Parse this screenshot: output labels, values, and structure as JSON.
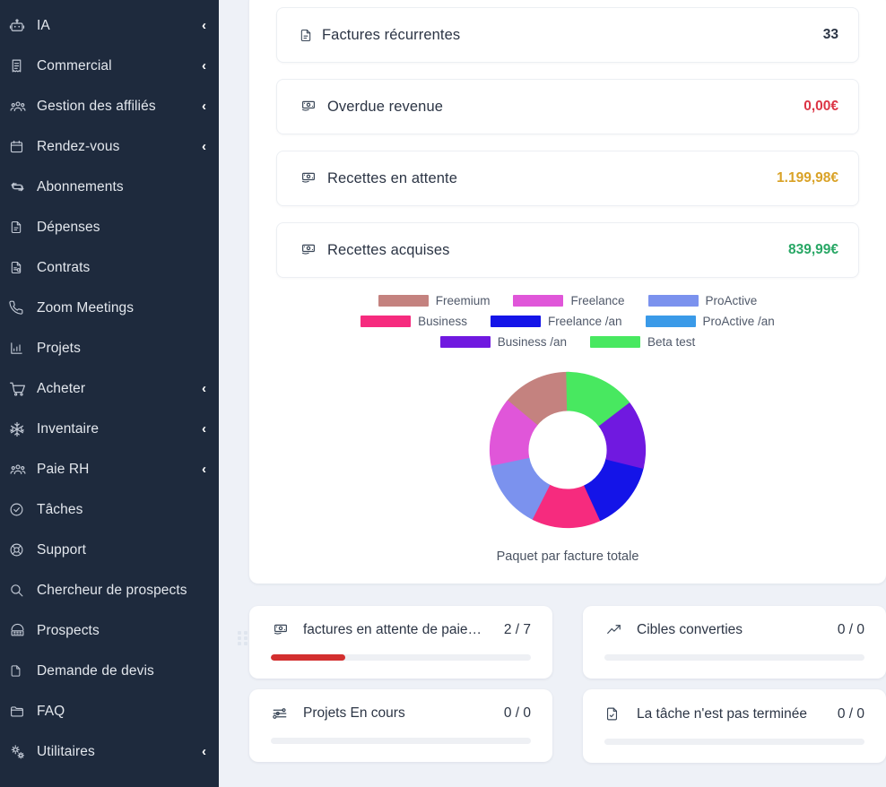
{
  "sidebar": {
    "items": [
      {
        "label": "IA",
        "icon": "robot-icon",
        "caret": "‹",
        "has_caret": true
      },
      {
        "label": "Commercial",
        "icon": "receipt-icon",
        "caret": "‹",
        "has_caret": true
      },
      {
        "label": "Gestion des affiliés",
        "icon": "users-group-icon",
        "caret": "‹",
        "has_caret": true
      },
      {
        "label": "Rendez-vous",
        "icon": "calendar-icon",
        "caret": "‹",
        "has_caret": true
      },
      {
        "label": "Abonnements",
        "icon": "refresh-cycle-icon",
        "caret": "",
        "has_caret": false
      },
      {
        "label": "Dépenses",
        "icon": "document-icon",
        "caret": "",
        "has_caret": false
      },
      {
        "label": "Contrats",
        "icon": "contract-icon",
        "caret": "",
        "has_caret": false
      },
      {
        "label": "Zoom Meetings",
        "icon": "phone-icon",
        "caret": "",
        "has_caret": false
      },
      {
        "label": "Projets",
        "icon": "bar-chart-icon",
        "caret": "",
        "has_caret": false
      },
      {
        "label": "Acheter",
        "icon": "shopping-cart-icon",
        "caret": "‹",
        "has_caret": true
      },
      {
        "label": "Inventaire",
        "icon": "snowflake-icon",
        "caret": "‹",
        "has_caret": true
      },
      {
        "label": "Paie RH",
        "icon": "users-group-icon",
        "caret": "‹",
        "has_caret": true
      },
      {
        "label": "Tâches",
        "icon": "check-circle-icon",
        "caret": "",
        "has_caret": false
      },
      {
        "label": "Support",
        "icon": "lifebuoy-icon",
        "caret": "",
        "has_caret": false
      },
      {
        "label": "Chercheur de prospects",
        "icon": "search-icon",
        "caret": "",
        "has_caret": false
      },
      {
        "label": "Prospects",
        "icon": "telephone-icon",
        "caret": "",
        "has_caret": false
      },
      {
        "label": "Demande de devis",
        "icon": "file-icon",
        "caret": "",
        "has_caret": false
      },
      {
        "label": "FAQ",
        "icon": "folder-icon",
        "caret": "",
        "has_caret": false
      },
      {
        "label": "Utilitaires",
        "icon": "gears-icon",
        "caret": "‹",
        "has_caret": true
      }
    ]
  },
  "stats": [
    {
      "label": "Factures récurrentes",
      "value": "33",
      "icon": "document-icon",
      "color": "#2c3545"
    },
    {
      "label": "Overdue revenue",
      "value": "0,00€",
      "icon": "banknote-icon",
      "color": "#dc3545"
    },
    {
      "label": "Recettes en attente",
      "value": "1.199,98€",
      "icon": "banknote-icon",
      "color": "#d9a227"
    },
    {
      "label": "Recettes acquises",
      "value": "839,99€",
      "icon": "banknote-icon",
      "color": "#28a765"
    }
  ],
  "chart_data": {
    "type": "pie",
    "title": "",
    "caption": "Paquet par facture totale",
    "legend_position": "top",
    "categories": [
      "Freemium",
      "Freelance",
      "ProActive",
      "Business",
      "Freelance /an",
      "ProActive /an",
      "Business /an",
      "Beta test"
    ],
    "legend": [
      {
        "label": "Freemium",
        "color": "#c4827f"
      },
      {
        "label": "Freelance",
        "color": "#e056d9"
      },
      {
        "label": "ProActive",
        "color": "#7b92ee"
      },
      {
        "label": "Business",
        "color": "#f62b7e"
      },
      {
        "label": "Freelance /an",
        "color": "#1414e8"
      },
      {
        "label": "ProActive /an",
        "color": "#3a9ae8"
      },
      {
        "label": "Business /an",
        "color": "#7019e0"
      },
      {
        "label": "Beta test",
        "color": "#48e860"
      }
    ],
    "slices": [
      {
        "label": "Freemium",
        "value": 1,
        "color": "#c4827f"
      },
      {
        "label": "Freelance",
        "value": 1,
        "color": "#e056d9"
      },
      {
        "label": "ProActive",
        "value": 1,
        "color": "#7b92ee"
      },
      {
        "label": "Business",
        "value": 1,
        "color": "#f62b7e"
      },
      {
        "label": "Freelance /an",
        "value": 1,
        "color": "#1414e8"
      },
      {
        "label": "Business /an",
        "value": 1,
        "color": "#7019e0"
      },
      {
        "label": "Beta test",
        "value": 1,
        "color": "#48e860"
      }
    ],
    "total": 7,
    "donut": true
  },
  "widgets": {
    "left": [
      {
        "title": "factures en attente de paie…",
        "count": "2 / 7",
        "icon": "banknote-icon",
        "progress_percent": 28.6,
        "progress_color": "#d32f2f"
      },
      {
        "title": "Projets En cours",
        "count": "0 / 0",
        "icon": "sliders-icon",
        "progress_percent": 0,
        "progress_color": "#d32f2f"
      }
    ],
    "right": [
      {
        "title": "Cibles converties",
        "count": "0 / 0",
        "icon": "trending-up-icon",
        "progress_percent": 0,
        "progress_color": "#d32f2f"
      },
      {
        "title": "La tâche n'est pas terminée",
        "count": "0 / 0",
        "icon": "file-check-icon",
        "progress_percent": 0,
        "progress_color": "#d32f2f"
      }
    ]
  },
  "colors": {
    "sidebar_bg": "#1e2a3d",
    "page_bg": "#eef1f7",
    "card_bg": "#ffffff",
    "text_primary": "#2c3545",
    "danger": "#dc3545",
    "warning": "#d9a227",
    "success": "#28a765"
  }
}
